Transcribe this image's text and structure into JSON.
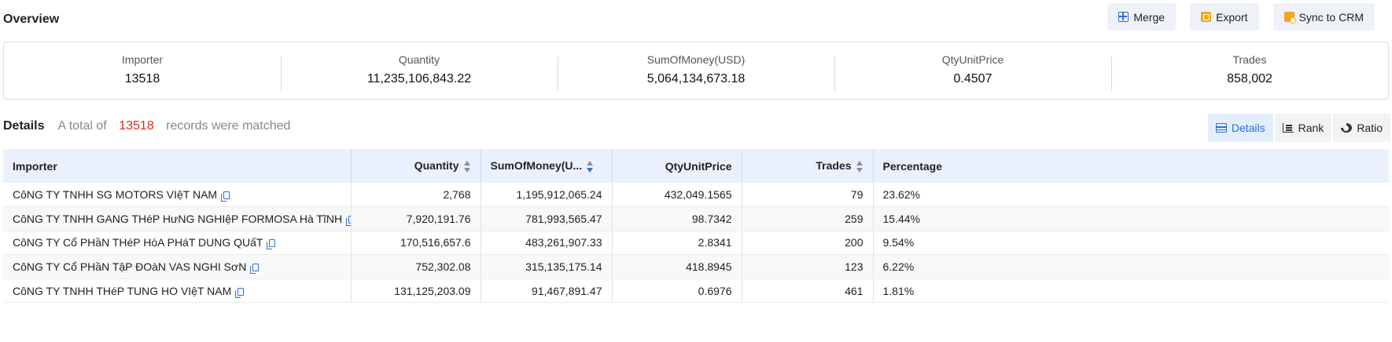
{
  "page": {
    "title": "Overview"
  },
  "toolbar": {
    "merge_label": "Merge",
    "export_label": "Export",
    "sync_label": "Sync to CRM"
  },
  "stats": [
    {
      "label": "Importer",
      "value": "13518"
    },
    {
      "label": "Quantity",
      "value": "11,235,106,843.22"
    },
    {
      "label": "SumOfMoney(USD)",
      "value": "5,064,134,673.18"
    },
    {
      "label": "QtyUnitPrice",
      "value": "0.4507"
    },
    {
      "label": "Trades",
      "value": "858,002"
    }
  ],
  "details": {
    "title": "Details",
    "prefix": "A total of",
    "count": "13518",
    "suffix": "records were matched"
  },
  "view_tabs": [
    {
      "label": "Details",
      "icon": "table-icon",
      "active": true
    },
    {
      "label": "Rank",
      "icon": "rank-icon",
      "active": false
    },
    {
      "label": "Ratio",
      "icon": "pie-icon",
      "active": false
    }
  ],
  "table": {
    "columns": [
      "Importer",
      "Quantity",
      "SumOfMoney(U...",
      "QtyUnitPrice",
      "Trades",
      "Percentage"
    ],
    "rows": [
      [
        "CôNG TY TNHH SG MOTORS VIệT NAM",
        "2,768",
        "1,195,912,065.24",
        "432,049.1565",
        "79",
        "23.62%"
      ],
      [
        "CôNG TY TNHH GANG THéP HưNG NGHIệP FORMOSA Hà TĩNH",
        "7,920,191.76",
        "781,993,565.47",
        "98.7342",
        "259",
        "15.44%"
      ],
      [
        "CôNG TY Cổ PHầN THéP HòA PHáT DUNG QUấT",
        "170,516,657.6",
        "483,261,907.33",
        "2.8341",
        "200",
        "9.54%"
      ],
      [
        "CôNG TY Cổ PHầN TậP ĐOàN VAS NGHI SơN",
        "752,302.08",
        "315,135,175.14",
        "418.8945",
        "123",
        "6.22%"
      ],
      [
        "CôNG TY TNHH THéP TUNG HO VIệT NAM",
        "131,125,203.09",
        "91,467,891.47",
        "0.6976",
        "461",
        "1.81%"
      ]
    ]
  },
  "colors": {
    "accent": "#2f6fd6",
    "highlight": "#e0281e",
    "header_bg": "#eaf1fc",
    "button_bg": "#eef1f8",
    "icon_orange": "#f0a91c"
  }
}
